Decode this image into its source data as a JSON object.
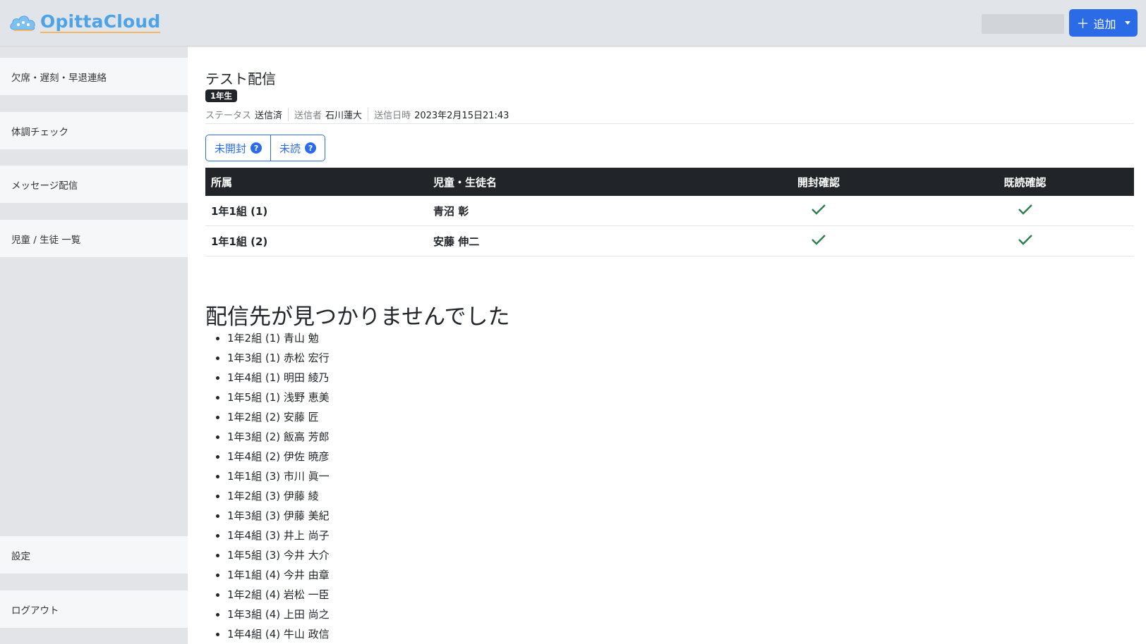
{
  "header": {
    "logo_text": "OpittaCloud",
    "add_button_label": "追加",
    "add_button_icon": "plus-icon"
  },
  "sidebar": {
    "items": [
      {
        "label": "欠席・遅刻・早退連絡"
      },
      {
        "label": "体調チェック"
      },
      {
        "label": "メッセージ配信"
      },
      {
        "label": "児童 / 生徒 一覧"
      },
      {
        "label": "設定"
      },
      {
        "label": "ログアウト"
      }
    ]
  },
  "message": {
    "title": "テスト配信",
    "grade_badge": "1年生",
    "status_key": "ステータス",
    "status_val": "送信済",
    "sender_key": "送信者",
    "sender_val": "石川蓮大",
    "sent_at_key": "送信日時",
    "sent_at_val": "2023年2月15日21:43"
  },
  "filters": {
    "unopened_label": "未開封",
    "unread_label": "未読"
  },
  "table": {
    "headers": [
      "所属",
      "児童・生徒名",
      "開封確認",
      "既読確認"
    ],
    "rows": [
      {
        "affiliation": "1年1組 (1)",
        "name": "青沼 彰",
        "opened": true,
        "read": true
      },
      {
        "affiliation": "1年1組 (2)",
        "name": "安藤 伸二",
        "opened": true,
        "read": true
      }
    ]
  },
  "not_found": {
    "title": "配信先が見つかりませんでした",
    "items": [
      "1年2組 (1) 青山 勉",
      "1年3組 (1) 赤松 宏行",
      "1年4組 (1) 明田 綾乃",
      "1年5組 (1) 浅野 恵美",
      "1年2組 (2) 安藤 匠",
      "1年3組 (2) 飯高 芳郎",
      "1年4組 (2) 伊佐 暁彦",
      "1年1組 (3) 市川 眞一",
      "1年2組 (3) 伊藤 綾",
      "1年3組 (3) 伊藤 美紀",
      "1年4組 (3) 井上 尚子",
      "1年5組 (3) 今井 大介",
      "1年1組 (4) 今井 由章",
      "1年2組 (4) 岩松 一臣",
      "1年3組 (4) 上田 尚之",
      "1年4組 (4) 牛山 政信"
    ]
  },
  "colors": {
    "primary": "#2b6ce6",
    "check": "#2e7d4f",
    "table_header_bg": "#212529"
  }
}
